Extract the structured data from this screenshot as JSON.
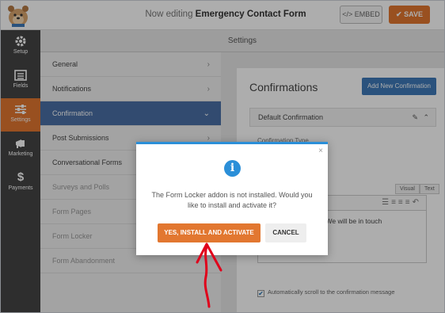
{
  "topbar": {
    "editing_prefix": "Now editing",
    "form_name": "Emergency Contact Form",
    "embed_label": "EMBED",
    "save_label": "SAVE"
  },
  "leftnav": {
    "items": [
      {
        "label": "Setup",
        "icon": "gear-icon"
      },
      {
        "label": "Fields",
        "icon": "list-icon"
      },
      {
        "label": "Settings",
        "icon": "sliders-icon"
      },
      {
        "label": "Marketing",
        "icon": "megaphone-icon"
      },
      {
        "label": "Payments",
        "icon": "dollar-icon"
      }
    ]
  },
  "settings_header": "Settings",
  "settings_panel": {
    "items": [
      {
        "label": "General"
      },
      {
        "label": "Notifications"
      },
      {
        "label": "Confirmation"
      },
      {
        "label": "Post Submissions"
      },
      {
        "label": "Conversational Forms"
      },
      {
        "label": "Surveys and Polls"
      },
      {
        "label": "Form Pages"
      },
      {
        "label": "Form Locker"
      },
      {
        "label": "Form Abandonment"
      }
    ]
  },
  "confirmations": {
    "title": "Confirmations",
    "add_new_label": "Add New Confirmation",
    "default_label": "Default Confirmation",
    "type_label": "Confirmation Type",
    "tab_visual": "Visual",
    "tab_text": "Text",
    "editor_text": "ng us! We will be in touch",
    "autoscroll_label": "Automatically scroll to the confirmation message"
  },
  "modal": {
    "message": "The Form Locker addon is not installed. Would you like to install and activate it?",
    "install_label": "YES, INSTALL AND ACTIVATE",
    "cancel_label": "CANCEL",
    "close_glyph": "×",
    "info_glyph": "i"
  },
  "colors": {
    "accent_orange": "#e27730",
    "nav_dark": "#444444",
    "active_blue": "#4a6fa5",
    "info_blue": "#2b8fd8",
    "annotation_red": "#e0001b"
  }
}
